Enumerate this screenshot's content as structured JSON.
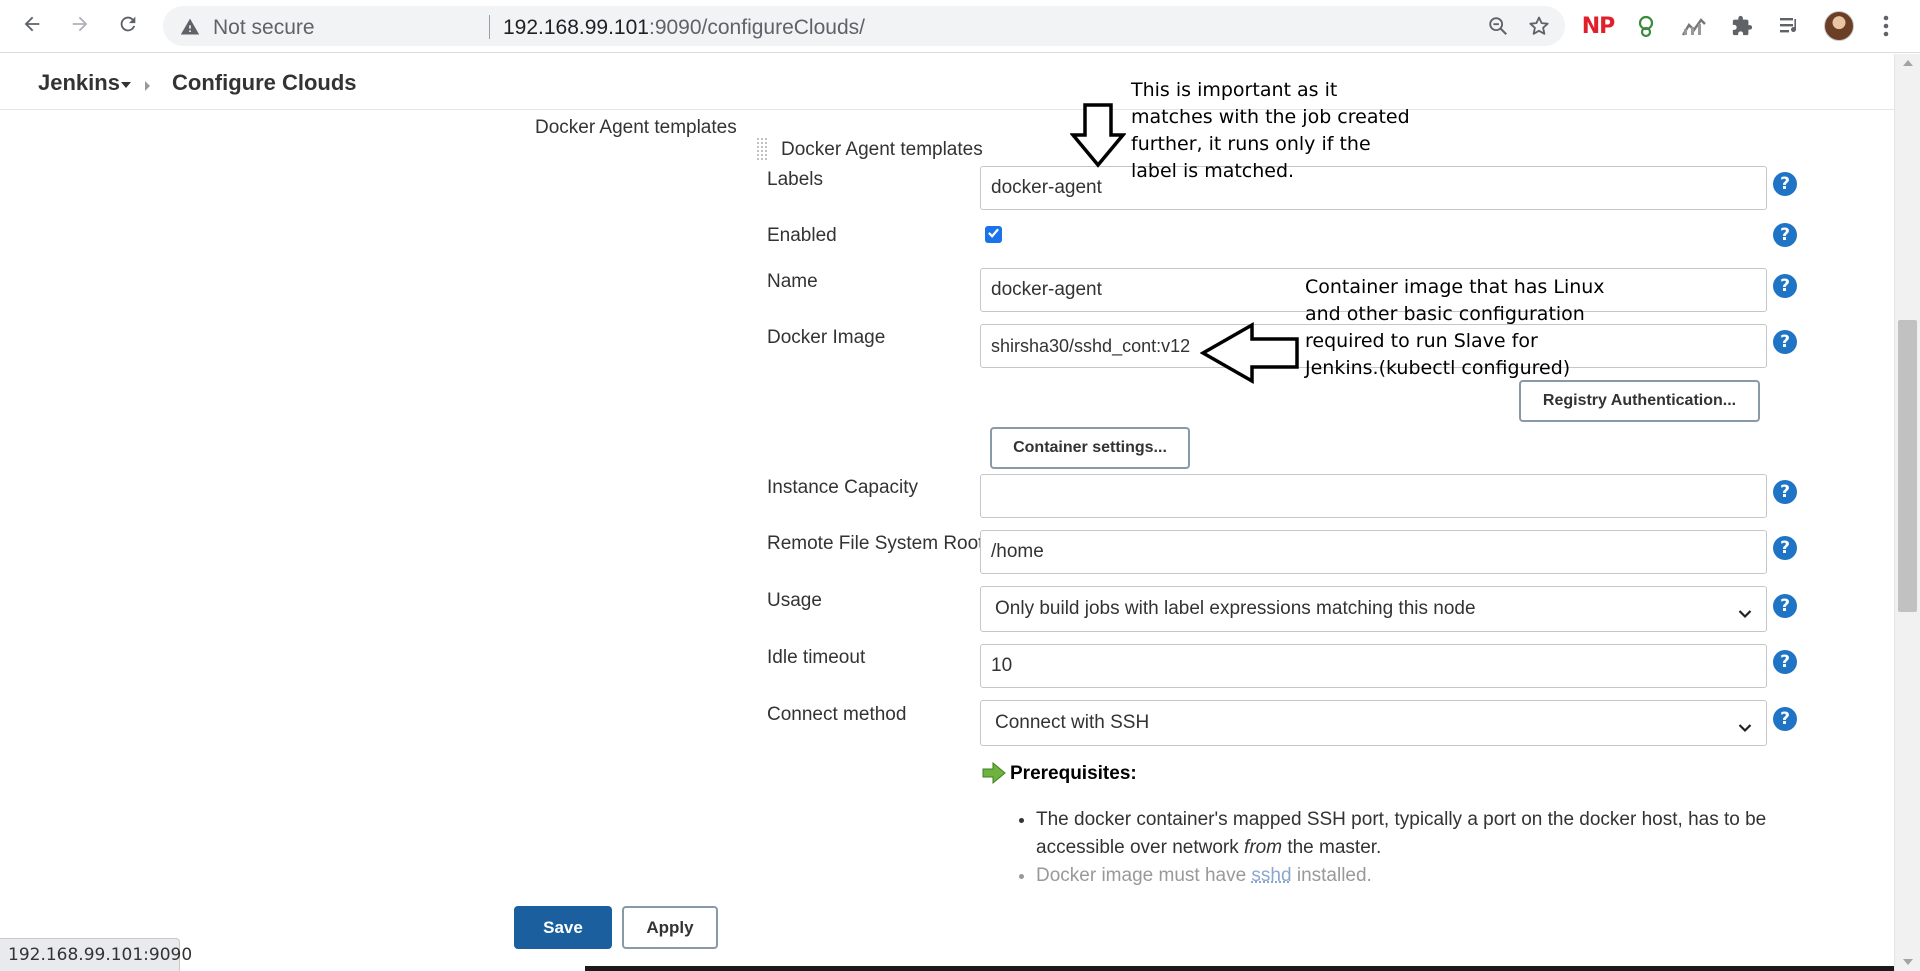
{
  "browser": {
    "security_label": "Not secure",
    "url_host": "192.168.99.101",
    "url_rest": ":9090/configureClouds/",
    "extension_np": "NP"
  },
  "breadcrumb": {
    "root": "Jenkins",
    "page": "Configure Clouds"
  },
  "section": {
    "outer_label": "Docker Agent templates",
    "inner_label": "Docker Agent templates"
  },
  "form": {
    "labels_label": "Labels",
    "labels_value": "docker-agent",
    "enabled_label": "Enabled",
    "enabled_checked": true,
    "name_label": "Name",
    "name_value": "docker-agent",
    "image_label": "Docker Image",
    "image_value": "shirsha30/sshd_cont:v12",
    "registry_button": "Registry Authentication...",
    "container_button": "Container settings...",
    "capacity_label": "Instance Capacity",
    "capacity_value": "",
    "root_label": "Remote File System Root",
    "root_value": "/home",
    "usage_label": "Usage",
    "usage_value": "Only build jobs with label expressions matching this node",
    "idle_label": "Idle timeout",
    "idle_value": "10",
    "connect_label": "Connect method",
    "connect_value": "Connect with SSH",
    "help_glyph": "?"
  },
  "prerequisites": {
    "title": "Prerequisites:",
    "item1_a": "The docker container's mapped SSH port, typically a port on the docker host, has to be accessible over network ",
    "item1_em": "from",
    "item1_b": " the master.",
    "item2_a": "Docker image must have ",
    "item2_link": "sshd",
    "item2_b": " installed."
  },
  "annotations": {
    "label_note": [
      "This is important as it",
      "matches with the job created",
      "further, it runs only if the",
      "label is matched."
    ],
    "image_note": [
      "Container image that has Linux",
      "and other basic configuration",
      "required to run Slave for",
      "Jenkins.(kubectl configured)"
    ]
  },
  "footer": {
    "save": "Save",
    "apply": "Apply",
    "status_url": "192.168.99.101:9090"
  },
  "colors": {
    "save_button": "#1b5f9e",
    "help_icon": "#1f74c5",
    "checkbox": "#1a73e8"
  }
}
